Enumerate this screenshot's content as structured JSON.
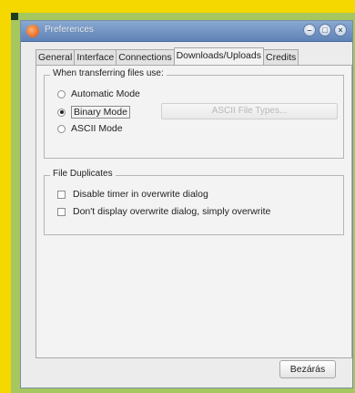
{
  "window": {
    "title": "Preferences"
  },
  "title_buttons": {
    "minimize": "–",
    "maximize": "□",
    "close": "×"
  },
  "tabs": [
    {
      "label": "General",
      "active": false
    },
    {
      "label": "Interface",
      "active": false
    },
    {
      "label": "Connections",
      "active": false
    },
    {
      "label": "Downloads/Uploads",
      "active": true
    },
    {
      "label": "Credits",
      "active": false
    }
  ],
  "transfer_group": {
    "title": "When transferring files use:",
    "options": [
      {
        "label": "Automatic Mode",
        "checked": false
      },
      {
        "label": "Binary Mode",
        "checked": true
      },
      {
        "label": "ASCII Mode",
        "checked": false
      }
    ],
    "ascii_button": "ASCII File Types..."
  },
  "duplicates_group": {
    "title": "File Duplicates",
    "options": [
      {
        "label": "Disable timer in overwrite dialog",
        "checked": false
      },
      {
        "label": "Don't display overwrite dialog, simply overwrite",
        "checked": false
      }
    ]
  },
  "footer": {
    "close_label": "Bezárás"
  },
  "colors": {
    "page_background": "#f4d800",
    "panel_green": "#a6c760",
    "titlebar": "#5f82b6"
  }
}
